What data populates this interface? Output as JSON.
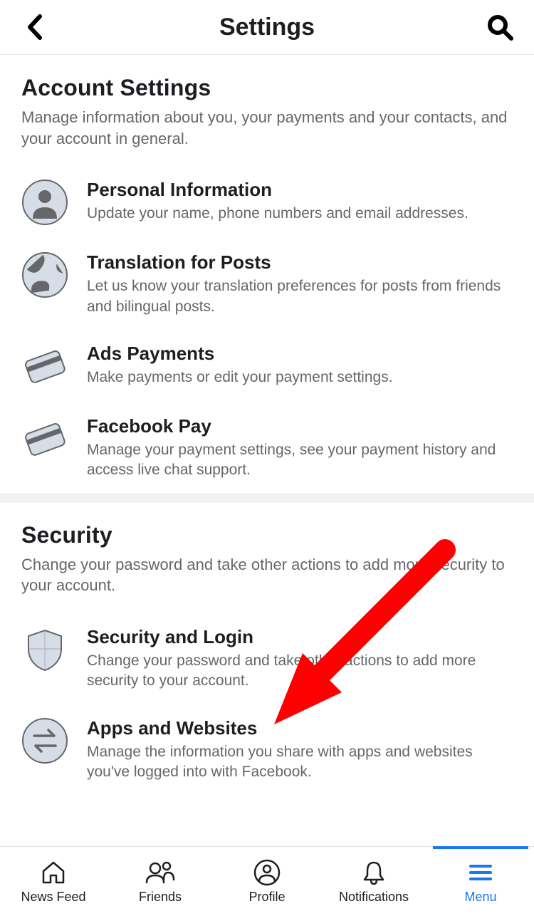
{
  "header": {
    "title": "Settings"
  },
  "sections": [
    {
      "title": "Account Settings",
      "desc": "Manage information about you, your payments and your contacts, and your account in general.",
      "items": [
        {
          "title": "Personal Information",
          "desc": "Update your name, phone numbers and email addresses."
        },
        {
          "title": "Translation for Posts",
          "desc": "Let us know your translation preferences for posts from friends and bilingual posts."
        },
        {
          "title": "Ads Payments",
          "desc": "Make payments or edit your payment settings."
        },
        {
          "title": "Facebook Pay",
          "desc": "Manage your payment settings, see your payment history and access live chat support."
        }
      ]
    },
    {
      "title": "Security",
      "desc": "Change your password and take other actions to add more security to your account.",
      "items": [
        {
          "title": "Security and Login",
          "desc": "Change your password and take other actions to add more security to your account."
        },
        {
          "title": "Apps and Websites",
          "desc": "Manage the information you share with apps and websites you've logged into with Facebook."
        }
      ]
    }
  ],
  "tabs": [
    {
      "label": "News Feed"
    },
    {
      "label": "Friends"
    },
    {
      "label": "Profile"
    },
    {
      "label": "Notifications"
    },
    {
      "label": "Menu"
    }
  ]
}
